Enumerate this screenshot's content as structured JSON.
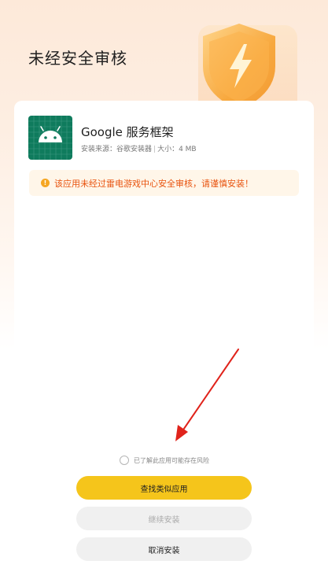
{
  "header": {
    "title": "未经安全审核"
  },
  "app": {
    "name": "Google 服务框架",
    "source": "安装来源：谷歌安装器",
    "size": "大小：4 MB"
  },
  "warning": {
    "text": "该应用未经过雷电游戏中心安全审核，请谨慎安装！"
  },
  "acknowledge": {
    "label": "已了解此应用可能存在风险"
  },
  "buttons": {
    "find_similar": "查找类似应用",
    "continue_install": "继续安装",
    "cancel_install": "取消安装"
  },
  "colors": {
    "primary_button": "#f5c51b",
    "warning_text": "#e8530e",
    "warning_bg": "#fff6e9",
    "app_icon_bg": "#0f7b5d",
    "arrow": "#e0231b"
  }
}
